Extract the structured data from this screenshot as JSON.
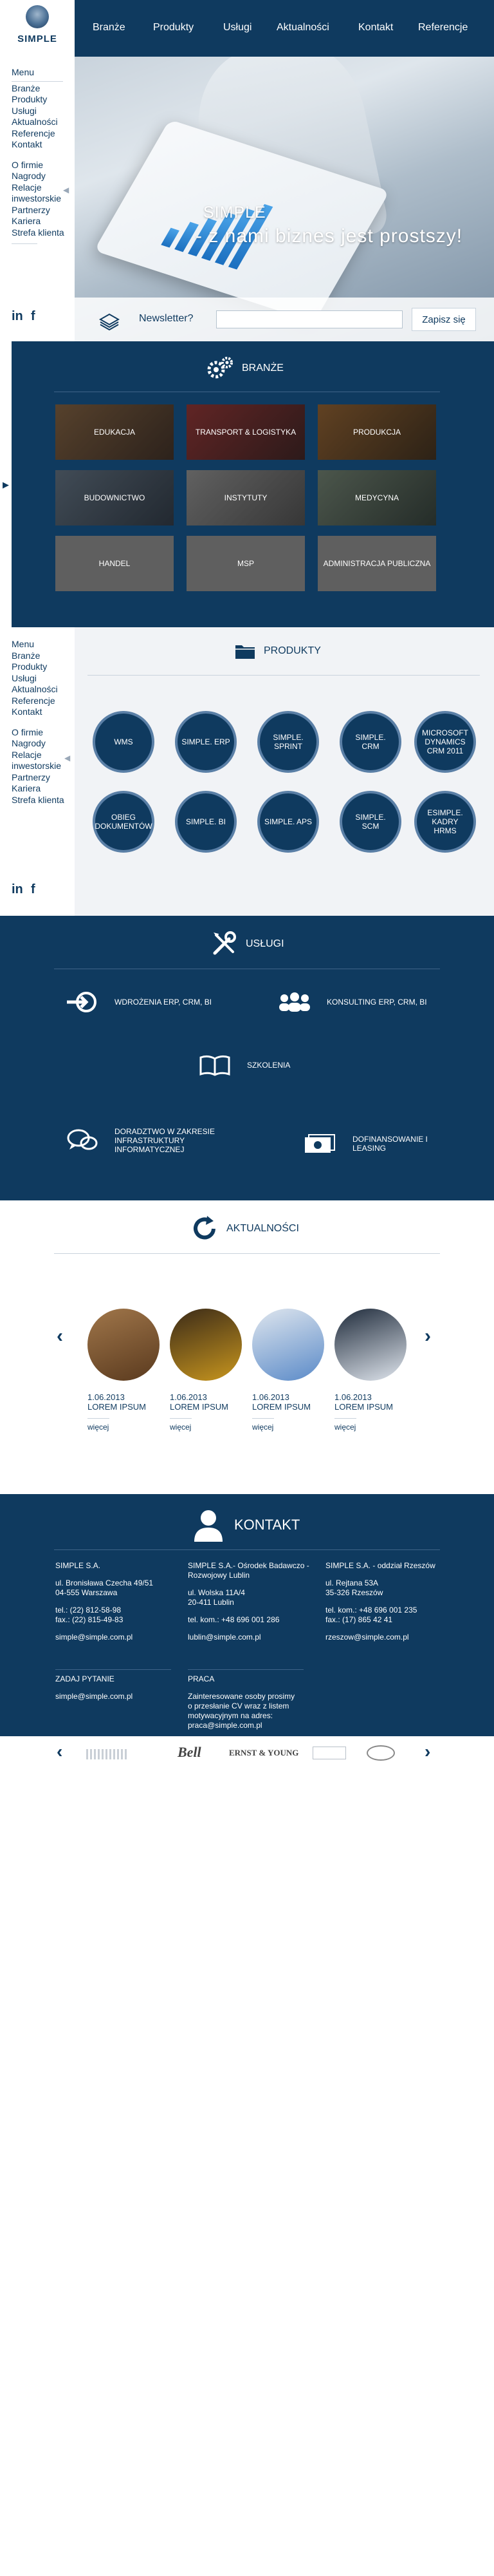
{
  "brand": {
    "name": "SIMPLE"
  },
  "nav": {
    "items": [
      "Branże",
      "Produkty",
      "Usługi",
      "Aktualności",
      "Kontakt",
      "Referencje"
    ]
  },
  "sidebar": {
    "menu_title": "Menu",
    "top_items": [
      "Branże",
      "Produkty",
      "Usługi",
      "Aktualności",
      "Referencje",
      "Kontakt"
    ],
    "info_items": [
      "O firmie",
      "Nagrody",
      "Relacje",
      "inwestorskie",
      "Partnerzy",
      "Kariera",
      "Strefa klienta"
    ],
    "social": {
      "linkedin": "in",
      "facebook": "f"
    }
  },
  "hero": {
    "title": "SIMPLE",
    "subtitle": "- z nami biznes jest prostszy!"
  },
  "newsletter": {
    "label": "Newsletter?",
    "placeholder": "",
    "button": "Zapisz się"
  },
  "branze": {
    "title": "BRANŻE",
    "tiles": [
      "EDUKACJA",
      "TRANSPORT & LOGISTYKA",
      "PRODUKCJA",
      "BUDOWNICTWO",
      "INSTYTUTY",
      "MEDYCYNA",
      "HANDEL",
      "MSP",
      "ADMINISTRACJA PUBLICZNA"
    ]
  },
  "produkty": {
    "title": "PRODUKTY",
    "items": [
      "WMS",
      "SIMPLE. ERP",
      "SIMPLE. SPRINT",
      "SIMPLE. CRM",
      "MICROSOFT DYNAMICS CRM 2011",
      "OBIEG DOKUMENTÓW",
      "SIMPLE. BI",
      "SIMPLE. APS",
      "SIMPLE. SCM",
      "eSIMPLE. KADRY HRMS"
    ]
  },
  "uslugi": {
    "title": "USŁUGI",
    "items": [
      {
        "label": "WDROŻENIA ERP, CRM, BI",
        "icon": "login-arrow-icon"
      },
      {
        "label": "KONSULTING ERP, CRM, BI",
        "icon": "people-icon"
      },
      {
        "label": "SZKOLENIA",
        "icon": "book-icon"
      },
      {
        "label": "DORADZTWO W ZAKRESIE INFRASTRUKTURY INFORMATYCZNEJ",
        "icon": "speech-bubbles-icon"
      },
      {
        "label": "DOFINANSOWANIE I LEASING",
        "icon": "money-icon"
      }
    ]
  },
  "aktualnosci": {
    "title": "AKTUALNOŚCI",
    "items": [
      {
        "date": "1.06.2013",
        "title": "LOREM IPSUM",
        "more": "więcej"
      },
      {
        "date": "1.06.2013",
        "title": "LOREM IPSUM",
        "more": "więcej"
      },
      {
        "date": "1.06.2013",
        "title": "LOREM IPSUM",
        "more": "więcej"
      },
      {
        "date": "1.06.2013",
        "title": "LOREM IPSUM",
        "more": "więcej"
      }
    ]
  },
  "kontakt": {
    "title": "KONTAKT",
    "offices": [
      {
        "name": "SIMPLE S.A.",
        "address": [
          "ul. Bronisława Czecha 49/51",
          "04-555 Warszawa"
        ],
        "phones": [
          "tel.: (22) 812-58-98",
          "fax.: (22) 815-49-83"
        ],
        "email": "simple@simple.com.pl"
      },
      {
        "name": "SIMPLE S.A.- Ośrodek Badawczo -Rozwojowy Lublin",
        "address": [
          "ul. Wolska 11A/4",
          "20-411 Lublin"
        ],
        "phones": [
          "tel. kom.: +48 696 001 286"
        ],
        "email": "lublin@simple.com.pl"
      },
      {
        "name": "SIMPLE S.A. - oddział Rzeszów",
        "address": [
          "ul. Rejtana 53A",
          "35-326 Rzeszów"
        ],
        "phones": [
          "tel. kom.: +48 696 001 235",
          "fax.: (17) 865 42 41"
        ],
        "email": "rzeszow@simple.com.pl"
      }
    ],
    "question": {
      "title": "ZADAJ PYTANIE",
      "email": "simple@simple.com.pl"
    },
    "praca": {
      "title": "PRACA",
      "text": [
        "Zainteresowane osoby prosimy",
        "o przesłanie CV wraz z listem",
        "motywacyjnym na adres:"
      ],
      "email": "praca@simple.com.pl"
    }
  },
  "partners": [
    "Bell",
    "ERNST & YOUNG"
  ],
  "colors": {
    "navy": "#0f3a5f",
    "accent_circle": "#5a7fa6",
    "text_light": "#ffffff"
  }
}
